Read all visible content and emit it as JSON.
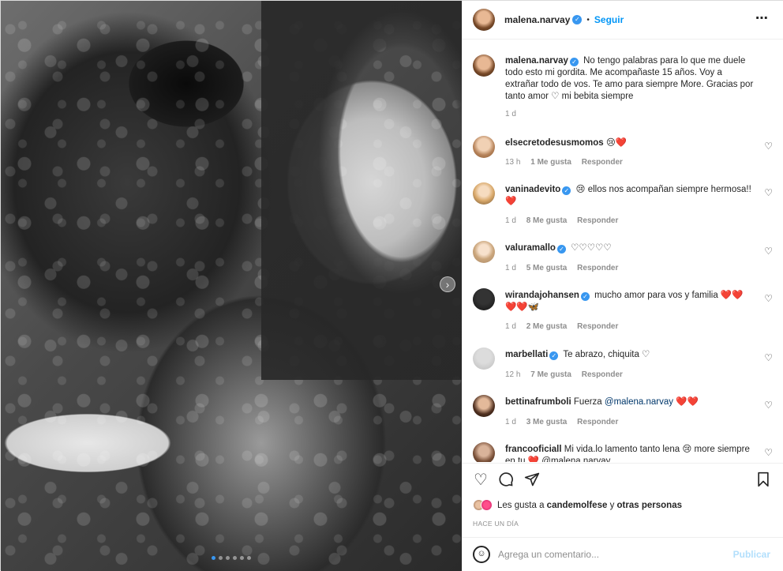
{
  "post": {
    "username": "malena.narvay",
    "follow_label": "Seguir",
    "separator": "•",
    "more_icon": "⋯"
  },
  "caption": {
    "username": "malena.narvay",
    "text": "No tengo palabras para lo que me duele todo esto mi gordita. Me acompañaste 15 años. Voy a extrañar todo de vos. Te amo para siempre More. Gracias por tanto amor ♡ mi bebita siempre",
    "time": "1 d"
  },
  "comments": [
    {
      "username": "elsecretodesusmomos",
      "verified": false,
      "text": "😢❤️",
      "time": "13 h",
      "likes": "1 Me gusta",
      "reply": "Responder"
    },
    {
      "username": "vaninadevito",
      "verified": true,
      "text": "😢 ellos nos acompañan siempre hermosa!! ❤️",
      "time": "1 d",
      "likes": "8 Me gusta",
      "reply": "Responder"
    },
    {
      "username": "valuramallo",
      "verified": true,
      "text": "♡♡♡♡♡",
      "time": "1 d",
      "likes": "5 Me gusta",
      "reply": "Responder"
    },
    {
      "username": "wirandajohansen",
      "verified": true,
      "text": "mucho amor para vos y familia ❤️❤️❤️❤️🦋",
      "time": "1 d",
      "likes": "2 Me gusta",
      "reply": "Responder"
    },
    {
      "username": "marbellati",
      "verified": true,
      "text": "Te abrazo, chiquita ♡",
      "time": "12 h",
      "likes": "7 Me gusta",
      "reply": "Responder"
    },
    {
      "username": "bettinafrumboli",
      "verified": false,
      "text_before": "Fuerza",
      "mention": "@malena.narvay",
      "text_after": "❤️❤️",
      "time": "1 d",
      "likes": "3 Me gusta",
      "reply": "Responder"
    },
    {
      "username": "francooficiall",
      "verified": false,
      "text": "Mi vida.lo lamento tanto lena 😢 more siempre en tu ❤️ @malena.narvay",
      "time": "",
      "likes": "",
      "reply": ""
    }
  ],
  "actions": {
    "likes_prefix": "Les gusta a",
    "likes_user": "candemolfese",
    "likes_conj": "y",
    "likes_others": "otras personas",
    "date": "HACE UN DÍA"
  },
  "add_comment": {
    "placeholder": "Agrega un comentario...",
    "publish_label": "Publicar"
  },
  "carousel": {
    "slide_count": 6,
    "active_index": 0
  },
  "colors": {
    "accent": "#0095f6",
    "verified": "#3897f0",
    "heart_red": "#ed1c24",
    "muted": "#8e8e8e"
  }
}
